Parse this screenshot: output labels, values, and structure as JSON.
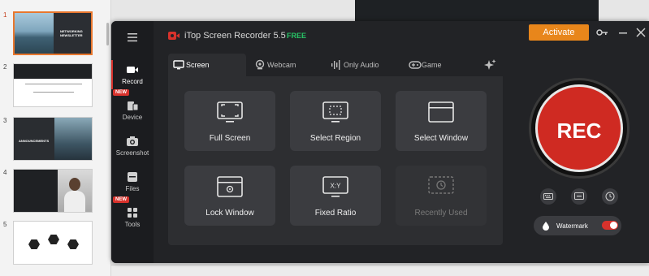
{
  "slides": {
    "numbers": [
      "1",
      "2",
      "3",
      "4",
      "5"
    ],
    "thumb1_text": "NETWORKING NEWSLETTER",
    "thumb3_text": "ANNOUNCEMENTS"
  },
  "app": {
    "title": "iTop Screen Recorder 5.5",
    "free_tag": "FREE",
    "activate_label": "Activate"
  },
  "nav": {
    "record": "Record",
    "device": "Device",
    "screenshot": "Screenshot",
    "files": "Files",
    "tools": "Tools",
    "new_badge": "NEW"
  },
  "tabs": {
    "screen": "Screen",
    "webcam": "Webcam",
    "only_audio": "Only Audio",
    "game": "Game"
  },
  "modes": {
    "full_screen": "Full Screen",
    "select_region": "Select Region",
    "select_window": "Select Window",
    "lock_window": "Lock Window",
    "fixed_ratio": "Fixed Ratio",
    "fixed_ratio_glyph": "X:Y",
    "recently_used": "Recently Used"
  },
  "rec": {
    "label": "REC",
    "watermark": "Watermark"
  },
  "colors": {
    "accent_red": "#cf2a22",
    "activate_orange": "#e8861b",
    "free_green": "#28c466"
  }
}
